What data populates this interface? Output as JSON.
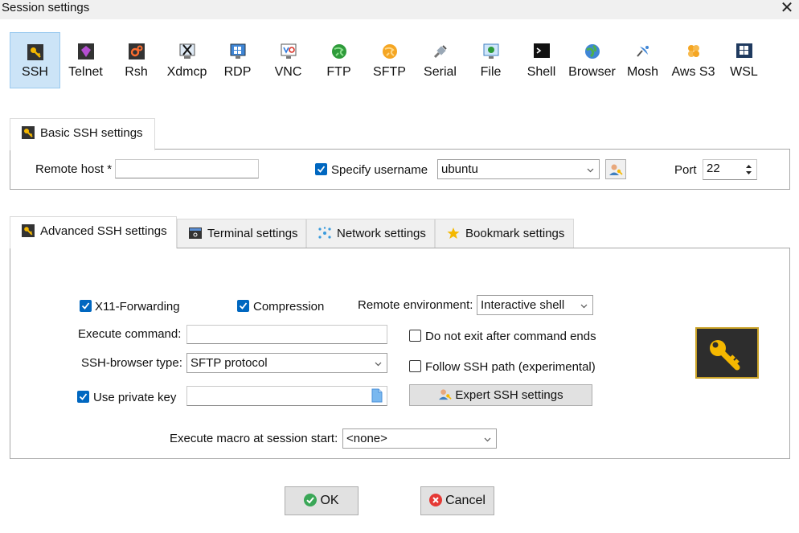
{
  "window": {
    "title": "Session settings",
    "close_glyph": "✕"
  },
  "session_types": [
    {
      "label": "SSH",
      "icon": "ssh-icon",
      "selected": true
    },
    {
      "label": "Telnet",
      "icon": "telnet-icon"
    },
    {
      "label": "Rsh",
      "icon": "rsh-icon"
    },
    {
      "label": "Xdmcp",
      "icon": "xdmcp-icon"
    },
    {
      "label": "RDP",
      "icon": "rdp-icon"
    },
    {
      "label": "VNC",
      "icon": "vnc-icon"
    },
    {
      "label": "FTP",
      "icon": "ftp-icon"
    },
    {
      "label": "SFTP",
      "icon": "sftp-icon"
    },
    {
      "label": "Serial",
      "icon": "serial-icon"
    },
    {
      "label": "File",
      "icon": "file-icon"
    },
    {
      "label": "Shell",
      "icon": "shell-icon"
    },
    {
      "label": "Browser",
      "icon": "browser-icon"
    },
    {
      "label": "Mosh",
      "icon": "mosh-icon"
    },
    {
      "label": "Aws S3",
      "icon": "aws-s3-icon"
    },
    {
      "label": "WSL",
      "icon": "wsl-icon"
    }
  ],
  "basic": {
    "tab_label": "Basic SSH settings",
    "remote_host_label": "Remote host *",
    "remote_host_value": "",
    "specify_username_label": "Specify username",
    "specify_username_checked": true,
    "username_value": "ubuntu",
    "port_label": "Port",
    "port_value": "22"
  },
  "tabs": [
    {
      "label": "Advanced SSH settings",
      "icon": "ssh-icon",
      "active": true
    },
    {
      "label": "Terminal settings",
      "icon": "terminal-icon"
    },
    {
      "label": "Network settings",
      "icon": "network-icon"
    },
    {
      "label": "Bookmark settings",
      "icon": "star-icon"
    }
  ],
  "advanced": {
    "x11_label": "X11-Forwarding",
    "x11_checked": true,
    "compression_label": "Compression",
    "compression_checked": true,
    "remote_env_label": "Remote environment:",
    "remote_env_value": "Interactive shell",
    "exec_cmd_label": "Execute command:",
    "exec_cmd_value": "",
    "no_exit_label": "Do not exit after command ends",
    "no_exit_checked": false,
    "browser_type_label": "SSH-browser type:",
    "browser_type_value": "SFTP protocol",
    "follow_path_label": "Follow SSH path (experimental)",
    "follow_path_checked": false,
    "private_key_label": "Use private key",
    "private_key_checked": true,
    "private_key_value": "",
    "expert_button": "Expert SSH settings",
    "macro_label": "Execute macro at session start:",
    "macro_value": "<none>"
  },
  "buttons": {
    "ok": "OK",
    "cancel": "Cancel"
  },
  "colors": {
    "accent": "#0067c0",
    "selected_bg": "#cce4f7",
    "ok_green": "#3aa757",
    "cancel_red": "#e53935",
    "key_yellow": "#f5b800"
  }
}
